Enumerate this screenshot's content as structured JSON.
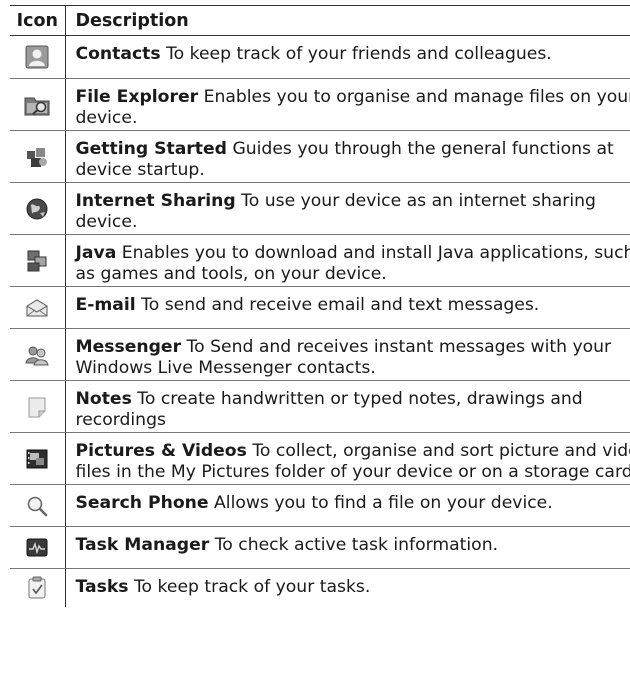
{
  "headers": {
    "icon": "Icon",
    "description": "Description"
  },
  "rows": [
    {
      "icon": "contacts-icon",
      "name": "Contacts",
      "lines": [
        "To keep track of your friends and colleagues."
      ]
    },
    {
      "icon": "file-explorer-icon",
      "name": "File Explorer",
      "lines": [
        "Enables you to organise and manage files on your",
        "device."
      ]
    },
    {
      "icon": "getting-started-icon",
      "name": "Getting Started",
      "lines": [
        "Guides you through the general functions at",
        "device startup."
      ]
    },
    {
      "icon": "internet-sharing-icon",
      "name": "Internet Sharing",
      "lines": [
        "To use your device as an internet sharing",
        "device."
      ]
    },
    {
      "icon": "java-icon",
      "name": "Java",
      "lines": [
        "Enables you to download and install Java applications, such",
        "as games and tools, on your device."
      ]
    },
    {
      "icon": "email-icon",
      "name": "E-mail",
      "lines": [
        "To send and receive email and text messages."
      ]
    },
    {
      "icon": "messenger-icon",
      "name": "Messenger",
      "lines": [
        "To Send and receives instant messages with your",
        "Windows Live Messenger contacts."
      ]
    },
    {
      "icon": "notes-icon",
      "name": "Notes",
      "lines": [
        "To create handwritten or typed notes, drawings and",
        "recordings"
      ]
    },
    {
      "icon": "pictures-videos-icon",
      "name": "Pictures & Videos",
      "lines": [
        "To collect, organise and sort picture and video",
        "files in the My Pictures folder of your device or on a storage card."
      ]
    },
    {
      "icon": "search-phone-icon",
      "name": "Search Phone",
      "lines": [
        "Allows you to find a file on your device."
      ]
    },
    {
      "icon": "task-manager-icon",
      "name": "Task Manager",
      "lines": [
        "To check active task information."
      ]
    },
    {
      "icon": "tasks-icon",
      "name": "Tasks",
      "lines": [
        "To keep track of your tasks."
      ]
    }
  ]
}
